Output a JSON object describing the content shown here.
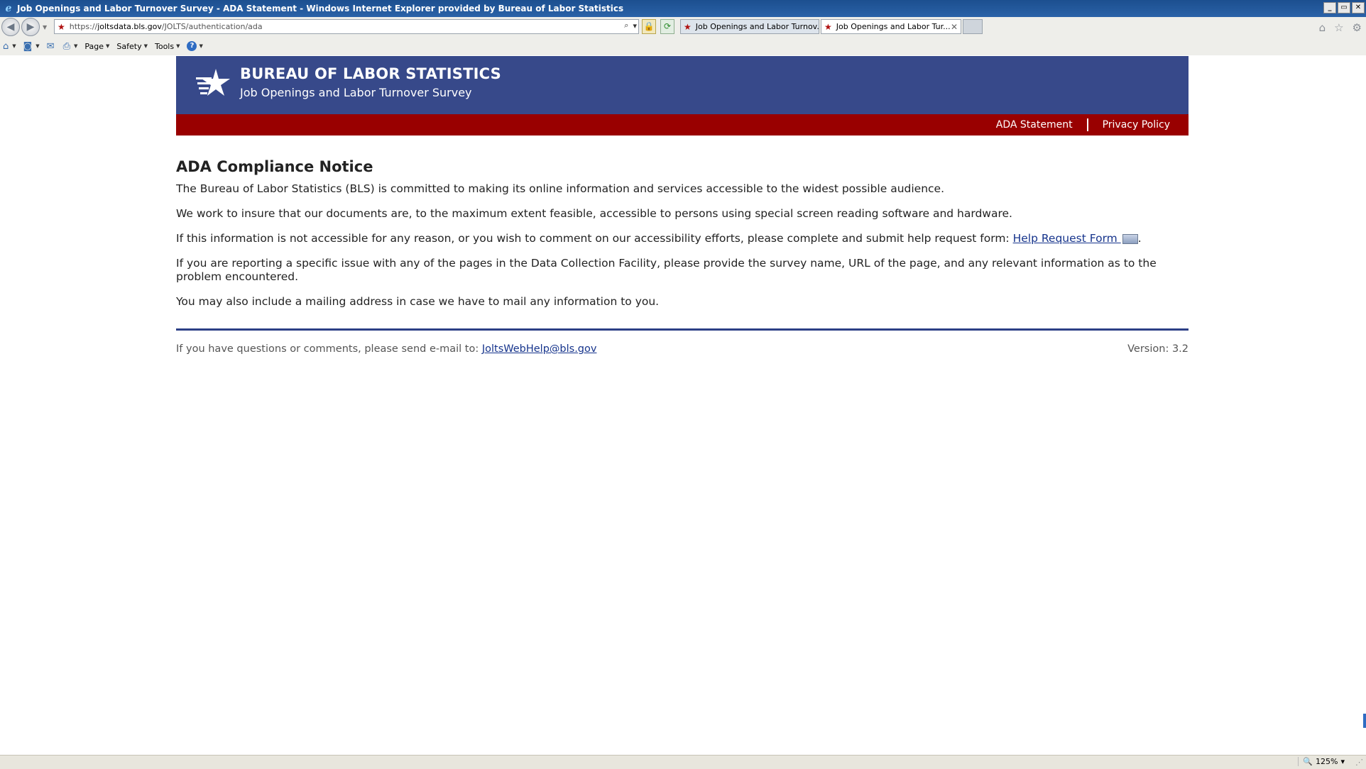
{
  "window": {
    "title": "Job Openings and Labor Turnover Survey - ADA Statement - Windows Internet Explorer provided by Bureau of Labor Statistics",
    "buttons": {
      "minimize": "_",
      "restore": "▭",
      "close": "✕"
    }
  },
  "addressbar": {
    "url_prefix": "https://",
    "url_host": "joltsdata.bls.gov",
    "url_path": "/JOLTS/authentication/ada",
    "search_glyph": "⌕",
    "dropdown_glyph": "▾",
    "lock_glyph": "🔒",
    "refresh_glyph": "⟳"
  },
  "tabs": [
    {
      "label": "Job Openings and Labor Turnov...",
      "active": false
    },
    {
      "label": "Job Openings and Labor Tur...",
      "active": true,
      "close": "✕"
    }
  ],
  "commandbar": {
    "page": "Page",
    "safety": "Safety",
    "tools": "Tools",
    "help": "?"
  },
  "header": {
    "agency": "BUREAU OF LABOR STATISTICS",
    "survey": "Job Openings and Labor Turnover Survey",
    "nav": {
      "ada": "ADA Statement",
      "privacy": "Privacy Policy"
    }
  },
  "content": {
    "heading": "ADA Compliance Notice",
    "p1": "The Bureau of Labor Statistics (BLS) is committed to making its online information and services accessible to the widest possible audience.",
    "p2": "We work to insure that our documents are, to the maximum extent feasible, accessible to persons using special screen reading software and hardware.",
    "p3_text": "If this information is not accessible for any reason, or you wish to comment on our accessibility efforts, please complete and submit help request form: ",
    "p3_link": "Help Request Form ",
    "p3_end": ".",
    "p4": "If you are reporting a specific issue with any of the pages in the Data Collection Facility, please provide the survey name, URL of the page, and any relevant information as to the problem encountered.",
    "p5": "You may also include a mailing address in case we have to mail any information to you."
  },
  "footer": {
    "text": "If you have questions or comments, please send e-mail to: ",
    "email": "JoltsWebHelp@bls.gov",
    "version": "Version: 3.2"
  },
  "statusbar": {
    "zoom": "125%"
  },
  "colors": {
    "header_blue": "#37498a",
    "header_red": "#990000",
    "divider": "#2c3f86"
  }
}
